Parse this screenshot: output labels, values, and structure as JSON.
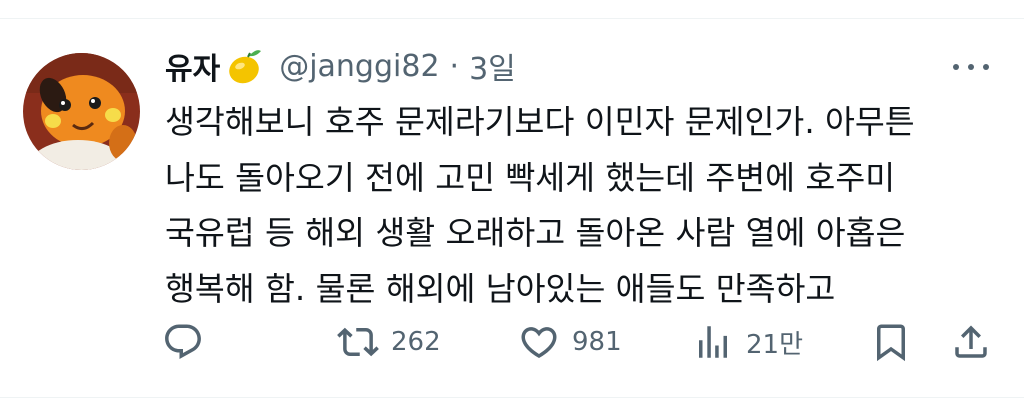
{
  "tweet": {
    "author_name": "유자",
    "handle": "@janggi82",
    "separator": "·",
    "time": "3일",
    "text_lines": [
      "생각해보니 호주 문제라기보다 이민자 문제인가. 아무튼",
      "나도 돌아오기 전에 고민 빡세게 했는데 주변에 호주미",
      "국유럽 등 해외 생활 오래하고 돌아온 사람 열에 아홉은",
      "행복해 함. 물론 해외에 남아있는 애들도 만족하고"
    ]
  },
  "actions": {
    "reply_icon": "speech-bubble-icon",
    "retweet_count": "262",
    "like_count": "981",
    "views_count": "21만"
  },
  "colors": {
    "text": "#0f1419",
    "secondary": "#536471",
    "divider": "#eff3f4",
    "lemon": "#f4c400"
  }
}
